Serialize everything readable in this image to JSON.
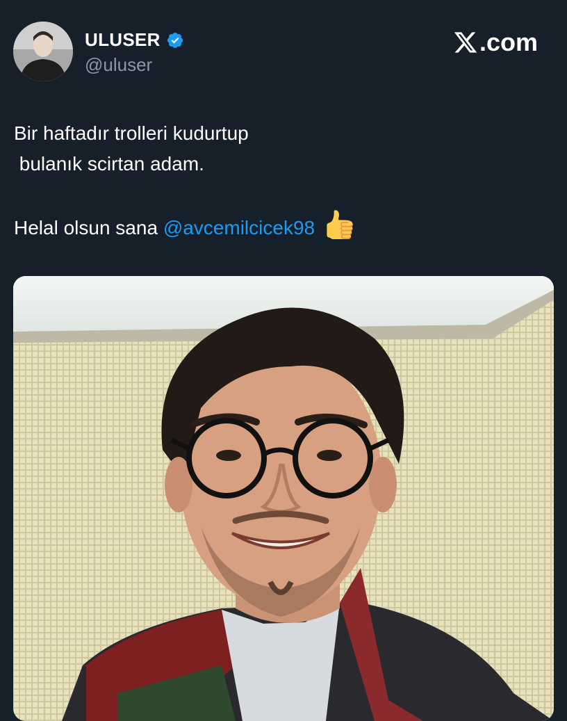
{
  "header": {
    "display_name": "ULUSER",
    "handle": "@uluser",
    "verified": true,
    "site_logo_text": ".com"
  },
  "tweet": {
    "line1": "Bir haftadır trolleri kudurtup",
    "line2": " bulanık scirtan adam.",
    "line3_prefix": "Helal olsun sana ",
    "mention": "@avcemilcicek98",
    "emoji": "thumbs-up-icon"
  },
  "colors": {
    "background": "#15202b",
    "mention": "#1d9bf0",
    "verified_badge": "#1d9bf0",
    "handle": "#8b98a5"
  }
}
